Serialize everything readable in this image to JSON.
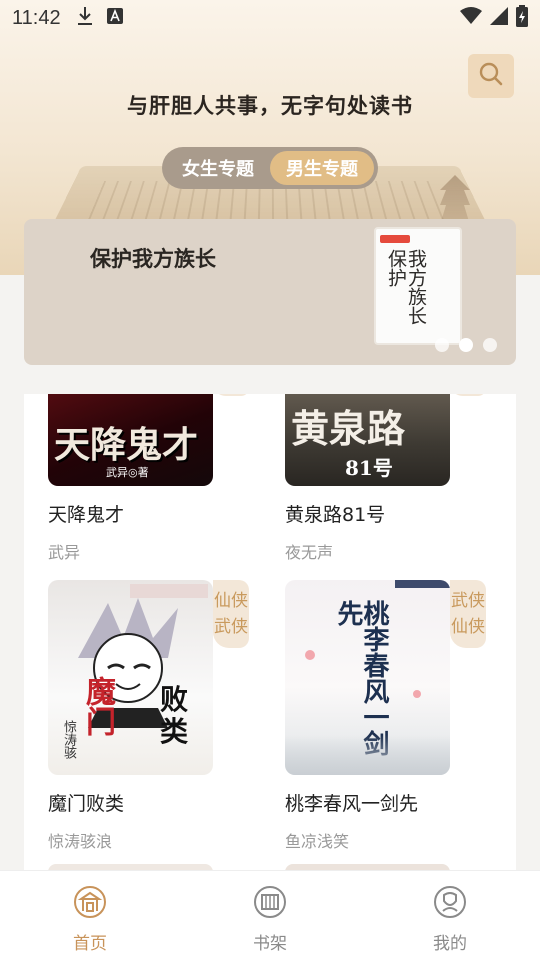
{
  "status_bar": {
    "time": "11:42"
  },
  "header": {
    "slogan": "与肝胆人共事，无字句处读书",
    "search_icon": "search-icon"
  },
  "gender_tabs": [
    {
      "label": "女生专题",
      "active": false
    },
    {
      "label": "男生专题",
      "active": true
    }
  ],
  "featured": {
    "title": "保护我方族长",
    "cover_text": "我方族长保护",
    "carousel_count": 3
  },
  "books": [
    {
      "title": "天降鬼才",
      "author": "武异",
      "tag": "",
      "cover_text": "天降鬼才",
      "cover_subtext": "武异◎著"
    },
    {
      "title": "黄泉路81号",
      "author": "夜无声",
      "tag": "",
      "cover_text": "黄泉路",
      "cover_subtext": "81号"
    },
    {
      "title": "魔门败类",
      "author": "惊涛骇浪",
      "tag": "仙侠武侠",
      "cover_text": "魔门败类",
      "cover_subtext": "惊涛骇"
    },
    {
      "title": "桃李春风一剑先",
      "author": "鱼凉浅笑",
      "tag": "武侠仙侠",
      "cover_text": "桃李春风一剑先",
      "cover_subtext": ""
    }
  ],
  "bottom_nav": [
    {
      "label": "首页",
      "icon": "home-icon",
      "active": true
    },
    {
      "label": "书架",
      "icon": "bookshelf-icon",
      "active": false
    },
    {
      "label": "我的",
      "icon": "profile-icon",
      "active": false
    }
  ],
  "colors": {
    "accent": "#c8935a",
    "tab_active": "#e1bd86",
    "tag_bg": "#f3e7d8",
    "tag_text": "#c99a5d"
  }
}
